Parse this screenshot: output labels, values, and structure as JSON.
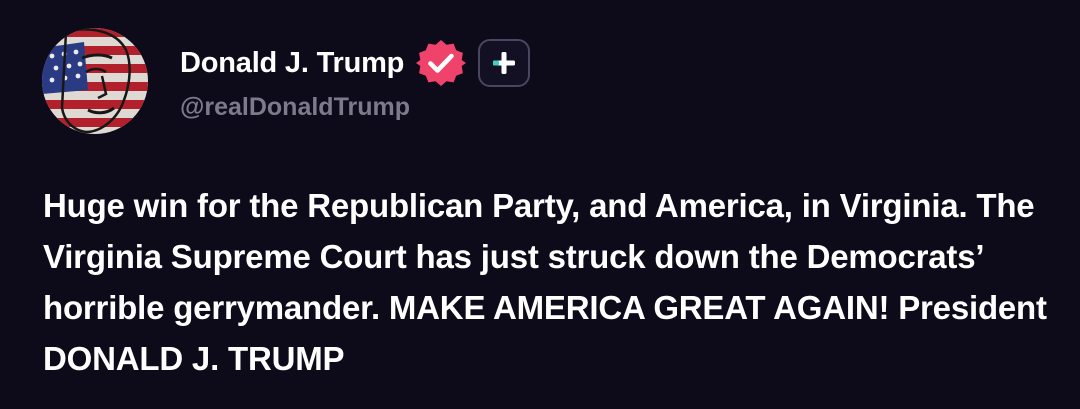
{
  "author": {
    "display_name": "Donald J. Trump",
    "handle": "@realDonaldTrump",
    "avatar_icon": "flag-portrait-avatar",
    "verified_icon": "verified-badge-icon",
    "verified_color": "#f0436b",
    "follow_icon": "plus-icon",
    "follow_icon_color": "#3ad1c4"
  },
  "post": {
    "text": "Huge win for the Republican Party, and America, in Virginia. The Virginia Supreme Court has just struck down the Democrats’ horrible gerrymander. MAKE AMERICA GREAT AGAIN! President DONALD J. TRUMP"
  },
  "theme": {
    "background": "#0d0a1a",
    "text": "#ffffff",
    "muted": "#7d7a8c"
  }
}
